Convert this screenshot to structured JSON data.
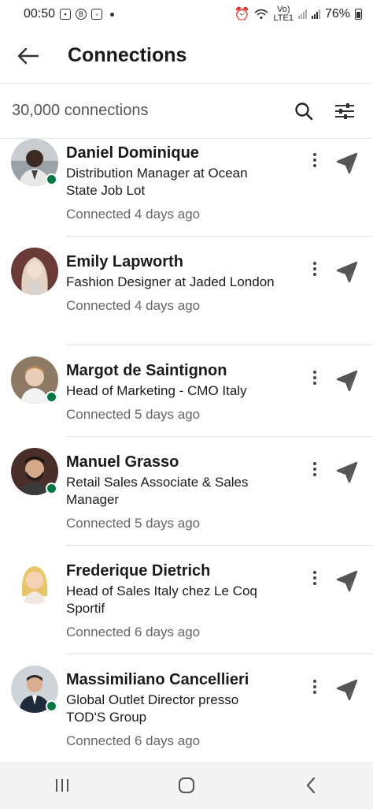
{
  "status_bar": {
    "time": "00:50",
    "volte": "Vo)",
    "lte": "LTE1",
    "battery_percent": "76%"
  },
  "header": {
    "title": "Connections",
    "back_icon": "arrow-left-icon"
  },
  "subheader": {
    "count_label": "30,000 connections",
    "search_icon": "search-icon",
    "filter_icon": "sliders-icon"
  },
  "connections": [
    {
      "name": "Daniel Dominique",
      "headline": "Distribution Manager at Ocean State Job Lot",
      "time": "Connected 4 days ago",
      "online": true
    },
    {
      "name": "Emily Lapworth",
      "headline": "Fashion Designer at Jaded London",
      "time": "Connected 4 days ago",
      "online": false
    },
    {
      "name": "Margot de Saintignon",
      "headline": "Head of Marketing - CMO Italy",
      "time": "Connected 5 days ago",
      "online": true
    },
    {
      "name": "Manuel Grasso",
      "headline": "Retail Sales Associate & Sales Manager",
      "time": "Connected 5 days ago",
      "online": true
    },
    {
      "name": "Frederique Dietrich",
      "headline": "Head of Sales Italy chez Le Coq Sportif",
      "time": "Connected 6 days ago",
      "online": false
    },
    {
      "name": "Massimiliano Cancellieri",
      "headline": "Global Outlet Director presso TOD'S Group",
      "time": "Connected 6 days ago",
      "online": true
    }
  ],
  "row_icons": {
    "more": "more-vertical-icon",
    "send": "send-message-icon"
  },
  "colors": {
    "online": "#057642",
    "text": "#1a1a1a",
    "muted": "#666666"
  },
  "nav_bar": {
    "recents_icon": "recent-apps-icon",
    "home_icon": "home-icon",
    "back_icon": "nav-back-icon"
  }
}
